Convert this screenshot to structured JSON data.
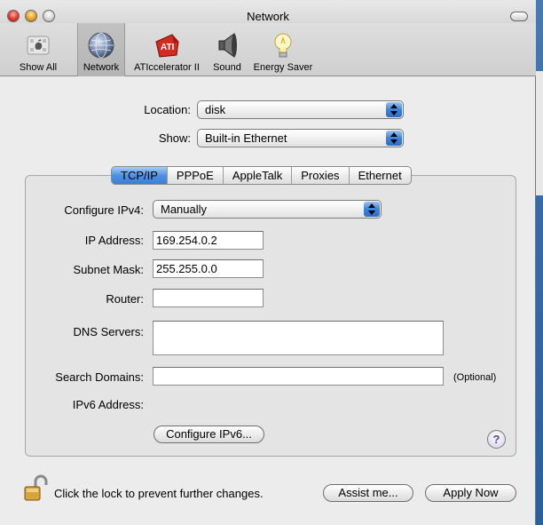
{
  "window": {
    "title": "Network"
  },
  "toolbar": {
    "items": [
      {
        "label": "Show All",
        "icon": "apple-grid-icon"
      },
      {
        "label": "Network",
        "icon": "globe-icon",
        "active": true
      },
      {
        "label": "ATIccelerator II",
        "icon": "ati-icon"
      },
      {
        "label": "Sound",
        "icon": "speaker-icon"
      },
      {
        "label": "Energy Saver",
        "icon": "lightbulb-icon"
      }
    ]
  },
  "location": {
    "label": "Location:",
    "value": "disk"
  },
  "show": {
    "label": "Show:",
    "value": "Built-in Ethernet"
  },
  "tabs": [
    {
      "label": "TCP/IP",
      "selected": true
    },
    {
      "label": "PPPoE"
    },
    {
      "label": "AppleTalk"
    },
    {
      "label": "Proxies"
    },
    {
      "label": "Ethernet"
    }
  ],
  "tcpip": {
    "configure": {
      "label": "Configure IPv4:",
      "value": "Manually"
    },
    "ip": {
      "label": "IP Address:",
      "value": "169.254.0.2"
    },
    "subnet": {
      "label": "Subnet Mask:",
      "value": "255.255.0.0"
    },
    "router": {
      "label": "Router:",
      "value": ""
    },
    "dns": {
      "label": "DNS Servers:",
      "value": ""
    },
    "search": {
      "label": "Search Domains:",
      "value": "",
      "hint": "(Optional)"
    },
    "ipv6": {
      "label": "IPv6 Address:"
    },
    "configure_ipv6_button": "Configure IPv6..."
  },
  "help": {
    "glyph": "?"
  },
  "footer": {
    "lock_text": "Click the lock to prevent further changes.",
    "assist_button": "Assist me...",
    "apply_button": "Apply Now"
  },
  "colors": {
    "selected_tab": "#3a7fd6",
    "desktop": "#2a5a92"
  }
}
